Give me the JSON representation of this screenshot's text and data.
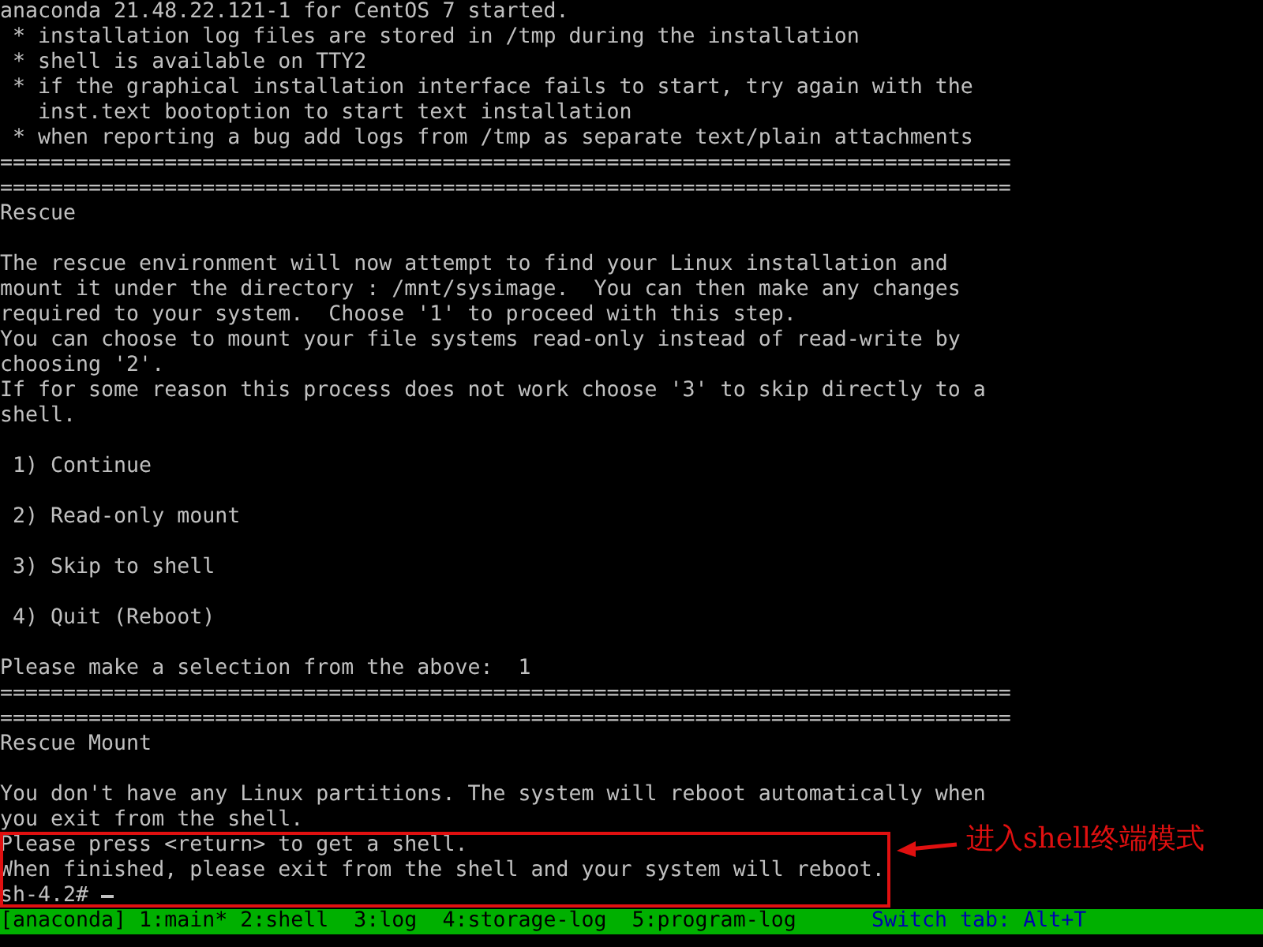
{
  "terminal": {
    "lines": [
      {
        "kind": "text",
        "text": "anaconda 21.48.22.121-1 for CentOS 7 started."
      },
      {
        "kind": "text",
        "text": " * installation log files are stored in /tmp during the installation"
      },
      {
        "kind": "text",
        "text": " * shell is available on TTY2"
      },
      {
        "kind": "text",
        "text": " * if the graphical installation interface fails to start, try again with the"
      },
      {
        "kind": "text",
        "text": "   inst.text bootoption to start text installation"
      },
      {
        "kind": "text",
        "text": " * when reporting a bug add logs from /tmp as separate text/plain attachments"
      },
      {
        "kind": "rule",
        "text": "================================================================================"
      },
      {
        "kind": "rule",
        "text": "================================================================================"
      },
      {
        "kind": "text",
        "text": "Rescue"
      },
      {
        "kind": "blank"
      },
      {
        "kind": "text",
        "text": "The rescue environment will now attempt to find your Linux installation and"
      },
      {
        "kind": "text",
        "text": "mount it under the directory : /mnt/sysimage.  You can then make any changes"
      },
      {
        "kind": "text",
        "text": "required to your system.  Choose '1' to proceed with this step."
      },
      {
        "kind": "text",
        "text": "You can choose to mount your file systems read-only instead of read-write by"
      },
      {
        "kind": "text",
        "text": "choosing '2'."
      },
      {
        "kind": "text",
        "text": "If for some reason this process does not work choose '3' to skip directly to a"
      },
      {
        "kind": "text",
        "text": "shell."
      },
      {
        "kind": "blank"
      },
      {
        "kind": "text",
        "text": " 1) Continue"
      },
      {
        "kind": "blank"
      },
      {
        "kind": "text",
        "text": " 2) Read-only mount"
      },
      {
        "kind": "blank"
      },
      {
        "kind": "text",
        "text": " 3) Skip to shell"
      },
      {
        "kind": "blank"
      },
      {
        "kind": "text",
        "text": " 4) Quit (Reboot)"
      },
      {
        "kind": "blank"
      },
      {
        "kind": "text",
        "text": "Please make a selection from the above:  1"
      },
      {
        "kind": "rule",
        "text": "================================================================================"
      },
      {
        "kind": "rule",
        "text": "================================================================================"
      },
      {
        "kind": "text",
        "text": "Rescue Mount"
      },
      {
        "kind": "blank"
      },
      {
        "kind": "text",
        "text": "You don't have any Linux partitions. The system will reboot automatically when"
      },
      {
        "kind": "text",
        "text": "you exit from the shell."
      },
      {
        "kind": "text",
        "text": "Please press <return> to get a shell."
      },
      {
        "kind": "text",
        "text": "When finished, please exit from the shell and your system will reboot."
      },
      {
        "kind": "prompt",
        "text": "sh-4.2#"
      }
    ]
  },
  "status_bar": {
    "left": "[anaconda] 1:main* 2:shell  3:log  4:storage-log  5:program-log",
    "right": "Switch tab: Alt+T"
  },
  "annotation": {
    "text": "进入shell终端模式"
  }
}
